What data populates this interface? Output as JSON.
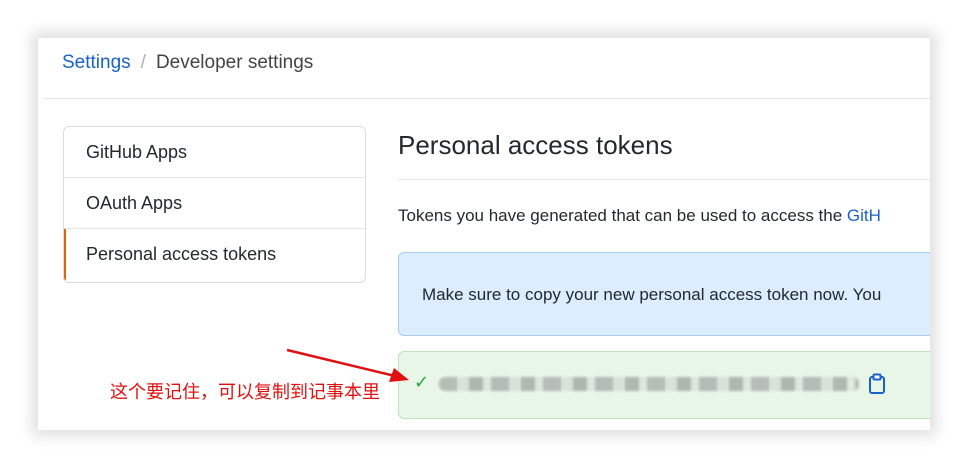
{
  "breadcrumb": {
    "settings": "Settings",
    "separator": "/",
    "developer": "Developer settings"
  },
  "sidebar": {
    "items": [
      {
        "label": "GitHub Apps",
        "active": false
      },
      {
        "label": "OAuth Apps",
        "active": false
      },
      {
        "label": "Personal access tokens",
        "active": true
      }
    ]
  },
  "main": {
    "title": "Personal access tokens",
    "description": "Tokens you have generated that can be used to access the ",
    "description_link": "GitH",
    "flash_info": "Make sure to copy your new personal access token now. You",
    "token": {
      "status_icon": "check-icon",
      "copy_icon": "clipboard-icon"
    }
  },
  "annotation": {
    "text": "这个要记住，可以复制到记事本里",
    "color": "#e01010"
  },
  "colors": {
    "link": "#1a62c7",
    "active_border": "#e36209",
    "info_bg": "#dbedff",
    "success_bg": "#e8f6e8",
    "check": "#28a745"
  }
}
